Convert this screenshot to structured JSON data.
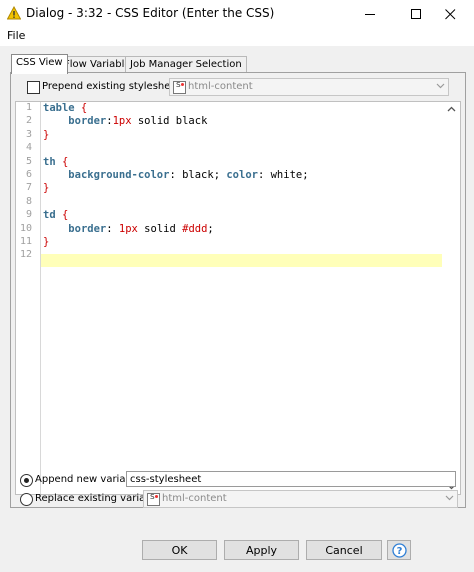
{
  "window": {
    "title": "Dialog - 3:32 - CSS Editor (Enter the CSS)",
    "icon": "warning-triangle-icon"
  },
  "menu": {
    "file": "File"
  },
  "tabs": [
    {
      "label": "CSS View",
      "active": true
    },
    {
      "label": "Flow Variables",
      "active": false
    },
    {
      "label": "Job Manager Selection",
      "active": false
    }
  ],
  "prepend": {
    "label": "Prepend existing stylesheet:",
    "checked": false,
    "select_value": "html-content"
  },
  "editor": {
    "line_numbers": [
      "1",
      "2",
      "3",
      "4",
      "5",
      "6",
      "7",
      "8",
      "9",
      "10",
      "11",
      "12"
    ],
    "code": {
      "l1_sel": "table",
      "l1_brace": " {",
      "l2_prop": "border",
      "l2_colon": ":",
      "l2_num": "1px",
      "l2_rest": " solid black",
      "l3": "}",
      "l5_sel": "th",
      "l5_brace": " {",
      "l6_prop1": "background-color",
      "l6_val1": ": black; ",
      "l6_prop2": "color",
      "l6_val2": ": white;",
      "l7": "}",
      "l9_sel": "td",
      "l9_brace": " {",
      "l10_prop": "border",
      "l10_colon": ": ",
      "l10_num": "1px",
      "l10_mid": " solid ",
      "l10_hex": "#ddd",
      "l10_end": ";",
      "l11": "}"
    }
  },
  "append_variable": {
    "label": "Append new variable:",
    "selected": true,
    "value": "css-stylesheet"
  },
  "replace_variable": {
    "label": "Replace existing variable:",
    "selected": false,
    "select_value": "html-content"
  },
  "buttons": {
    "ok": "OK",
    "apply": "Apply",
    "cancel": "Cancel"
  },
  "colors": {
    "selector": "#3a6f8f",
    "brace": "#cc0000",
    "current_line": "#ffffb9",
    "title_icon": "#e8b400"
  }
}
